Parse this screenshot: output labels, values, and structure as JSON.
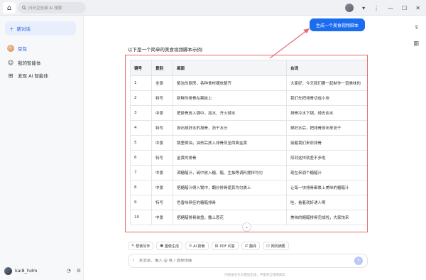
{
  "topbar": {
    "home_icon": "home-icon",
    "search_placeholder": "问问豆包或 AI 搜索",
    "controls": [
      "minimize-icon",
      "maximize-icon",
      "close-icon"
    ]
  },
  "sidebar": {
    "new_chat_label": "新对话",
    "items": [
      {
        "label": "豆包",
        "icon": "doubao-avatar",
        "active": true
      },
      {
        "label": "我的智能体",
        "icon": "agents-icon",
        "active": false
      },
      {
        "label": "发现 AI 智能体",
        "icon": "discover-icon",
        "active": false
      }
    ],
    "user": {
      "name": "kai8_hdm"
    }
  },
  "chat": {
    "user_message": "生成一个美食视频脚本",
    "intro_text": "以下是一个简单的美食视频脚本示例:",
    "table": {
      "headers": [
        "镜号",
        "景别",
        "画面",
        "台词"
      ],
      "rows": [
        [
          "1",
          "全景",
          "整洁的厨房，各种食材摆放整齐",
          "大家好，今天我们要一起制作一道美味的"
        ],
        [
          "2",
          "特写",
          "新鲜的排骨在案板上",
          "我们先把排骨切成小块"
        ],
        [
          "3",
          "中景",
          "把排骨放入锅中，加水、开火焯水",
          "排骨冷水下锅，焯去血水"
        ],
        [
          "4",
          "特写",
          "捞出焯好水的排骨，沥干水分",
          "焯好水后，把排骨捞出来沥干"
        ],
        [
          "5",
          "中景",
          "锅里倒油，油热后放入排骨煎至两面金黄",
          "接着我们来煎排骨"
        ],
        [
          "6",
          "特写",
          "金黄的排骨",
          "煎到这样就差不多啦"
        ],
        [
          "7",
          "中景",
          "调糖醋汁，碗中放入糖、醋、生抽等调料搅拌均匀",
          "现在来调个糖醋汁"
        ],
        [
          "8",
          "中景",
          "把糖醋汁倒入锅中，翻炒排骨使其均匀裹上",
          "让每一块排骨都裹上美味的糖醋汁"
        ],
        [
          "9",
          "特写",
          "色香味俱佳的糖醋排骨",
          "哇，看着就好诱人啊"
        ],
        [
          "10",
          "中景",
          "把糖醋排骨装盘，撒上葱花",
          "美味的糖醋排骨完成啦，大家快来"
        ]
      ]
    }
  },
  "tools": [
    "帮我写作",
    "图像生成",
    "AI 搜索",
    "PDF 问答",
    "翻译",
    "网页摘要"
  ],
  "input": {
    "placeholder": "发消息、输入 @ 或 / 选择技能"
  },
  "footer_note": "内容由豆包大模型生成，不能完全保障真实"
}
